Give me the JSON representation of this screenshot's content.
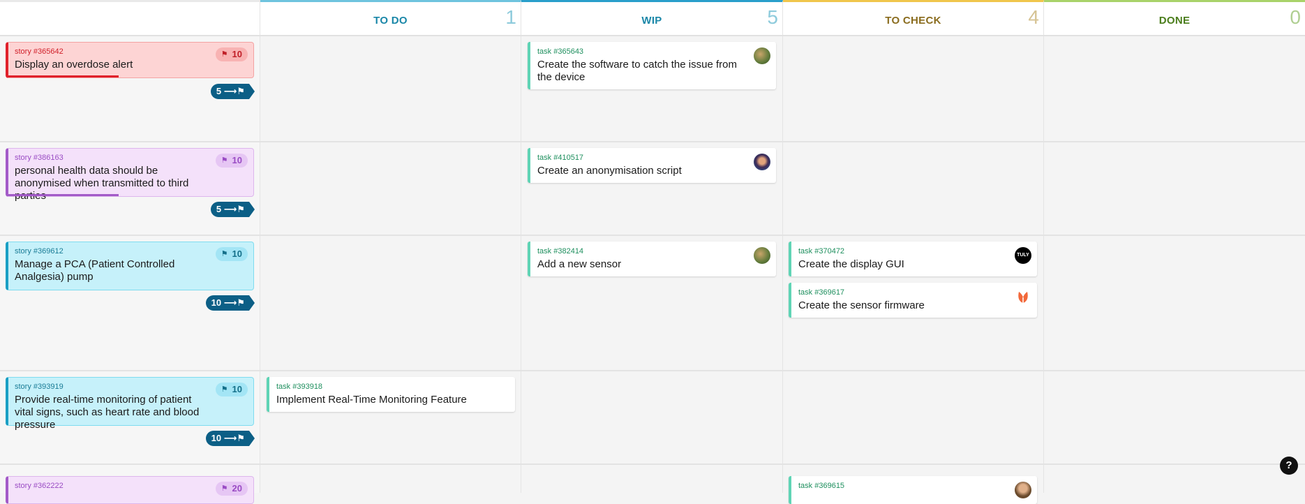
{
  "columns": [
    {
      "title": "TO DO",
      "count": "1",
      "color": "#1a87a8",
      "count_color": "#8ecbdc",
      "accent": "#6fc4de"
    },
    {
      "title": "WIP",
      "count": "5",
      "color": "#1a87a8",
      "count_color": "#8ecbdc",
      "accent": "#2a9fcb"
    },
    {
      "title": "TO CHECK",
      "count": "4",
      "color": "#8a6c1e",
      "count_color": "#d6c394",
      "accent": "#f0c64c"
    },
    {
      "title": "DONE",
      "count": "0",
      "color": "#4a7d1b",
      "count_color": "#b0cf92",
      "accent": "#a9d36a"
    }
  ],
  "stories": [
    {
      "ref": "story #365642",
      "title": "Display an overdose alert",
      "comments": "10",
      "points": "5",
      "bg": "#fdd4d4",
      "border": "#f3a3a3",
      "accent": "#e0212b",
      "ref_color": "#d1202a",
      "badge_bg": "#f8b3b3",
      "badge_color": "#c01f27",
      "progress": 0.45
    },
    {
      "ref": "story #386163",
      "title": "personal health data should be anonymised when transmitted to third parties",
      "comments": "10",
      "points": "5",
      "bg": "#f4e1fa",
      "border": "#ddb6ec",
      "accent": "#a35bc8",
      "ref_color": "#9a4cc4",
      "badge_bg": "#e6c6f4",
      "badge_color": "#9a4cc4",
      "progress": 0.45
    },
    {
      "ref": "story #369612",
      "title": "Manage a PCA (Patient Controlled Analgesia) pump",
      "comments": "10",
      "points": "10",
      "bg": "#c6f1fa",
      "border": "#7fdcef",
      "accent": "#1a9fc4",
      "ref_color": "#1a7c96",
      "badge_bg": "#a3e5f5",
      "badge_color": "#14708a",
      "progress": 0
    },
    {
      "ref": "story #393919",
      "title": "Provide real-time monitoring of patient vital signs, such as heart rate and blood pressure",
      "comments": "10",
      "points": "10",
      "bg": "#c6f1fa",
      "border": "#7fdcef",
      "accent": "#1a9fc4",
      "ref_color": "#1a7c96",
      "badge_bg": "#a3e5f5",
      "badge_color": "#14708a",
      "progress": 0
    },
    {
      "ref": "story #362222",
      "title": "",
      "comments": "20",
      "points": "",
      "bg": "#f4e1fa",
      "border": "#ddb6ec",
      "accent": "#a35bc8",
      "ref_color": "#9a4cc4",
      "badge_bg": "#e6c6f4",
      "badge_color": "#9a4cc4",
      "progress": 0
    }
  ],
  "tasks": [
    {
      "ref": "task #365643",
      "title": "Create the software to catch the issue from the device",
      "avatar": "avatar-photo-1"
    },
    {
      "ref": "task #410517",
      "title": "Create an anonymisation script",
      "avatar": "avatar-photo-2"
    },
    {
      "ref": "task #382414",
      "title": "Add a new sensor",
      "avatar": "avatar-photo-1"
    },
    {
      "ref": "task #370472",
      "title": "Create the display GUI",
      "avatar": "tuly-logo",
      "avatar_text": "TULY"
    },
    {
      "ref": "task #369617",
      "title": "Create the sensor firmware",
      "avatar": "tulip-logo"
    },
    {
      "ref": "task #393918",
      "title": "Implement Real-Time Monitoring Feature",
      "avatar": ""
    },
    {
      "ref": "task #369615",
      "title": "",
      "avatar": "avatar-photo-3"
    }
  ],
  "help": {
    "label": "?"
  }
}
